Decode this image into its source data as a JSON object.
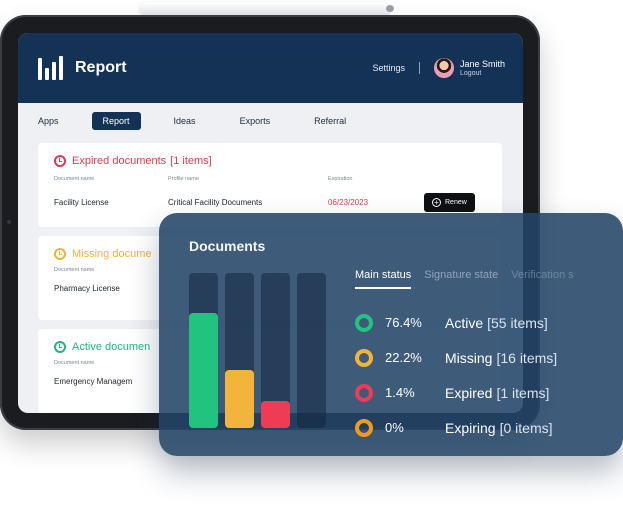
{
  "app": {
    "title": "Report"
  },
  "header": {
    "settings_label": "Settings",
    "user_name": "Jane Smith",
    "logout_label": "Logout"
  },
  "tabs": [
    "Apps",
    "Report",
    "Ideas",
    "Exports",
    "Referral"
  ],
  "active_tab": "Report",
  "cards": {
    "expired": {
      "title": "Expired documents",
      "count": "[1 items]",
      "columns": [
        "Document name",
        "Profile name",
        "Expiration"
      ],
      "row": {
        "document": "Facility License",
        "profile": "Critical Facility Documents",
        "expiration": "06/23/2023",
        "action": "Renew"
      }
    },
    "missing": {
      "title": "Missing docume",
      "columns": [
        "Document name"
      ],
      "row": {
        "document": "Pharmacy License"
      }
    },
    "active": {
      "title": "Active documen",
      "columns": [
        "Document name"
      ],
      "row": {
        "document": "Emergency Managem"
      }
    }
  },
  "panel": {
    "title": "Documents",
    "tabs": [
      "Main status",
      "Signature state",
      "Verification s"
    ],
    "active_tab": "Main status"
  },
  "chart_data": {
    "type": "bar",
    "categories": [
      "Active",
      "Missing",
      "Expired",
      "Expiring"
    ],
    "values": [
      76.4,
      22.2,
      1.4,
      0
    ],
    "percent_labels": [
      "76.4%",
      "22.2%",
      "1.4%",
      "0%"
    ],
    "counts": [
      "[55 items]",
      "[16 items]",
      "[1 items]",
      "[0 items]"
    ],
    "ylim": [
      0,
      100
    ],
    "colors": [
      "#22c37e",
      "#f2b43a",
      "#f03b55",
      "#f39a1d"
    ]
  },
  "colors": {
    "brand": "#143256",
    "expired": "#e2394d",
    "missing": "#f0b237",
    "active": "#22b77a"
  }
}
